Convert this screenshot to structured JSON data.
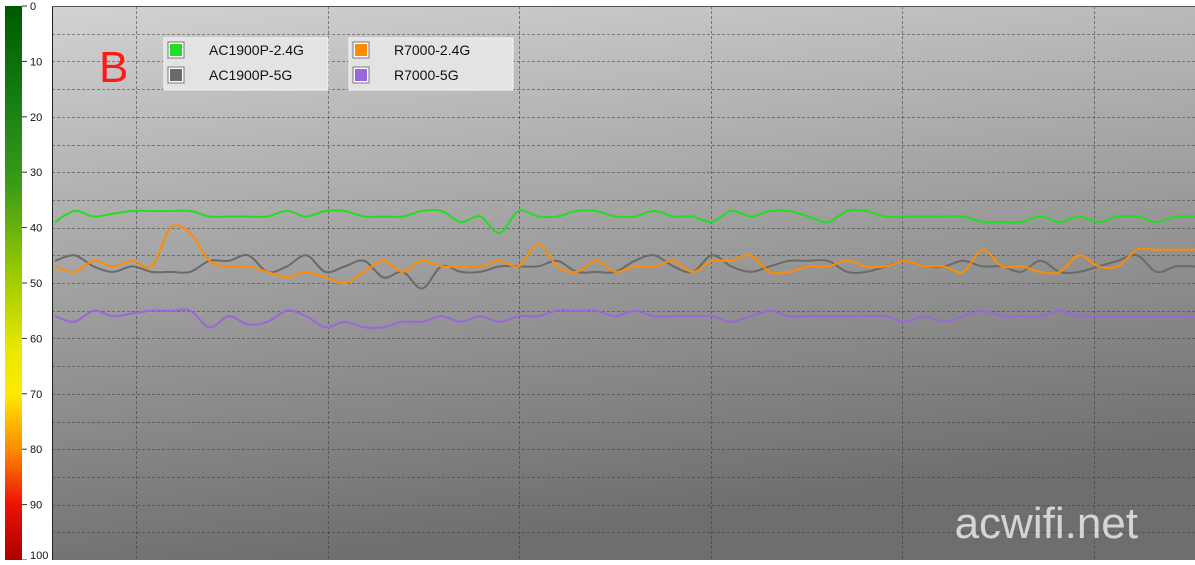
{
  "panel_letter": "B",
  "watermark": "acwifi.net",
  "colors": {
    "panel_letter": "#ff1a1a",
    "watermark": "#e8e8e8",
    "plot_grad_top": "#d2d2d2",
    "plot_grad_bottom": "#6e6e6e",
    "legend_bg": "#e3e3e3"
  },
  "chart_data": {
    "type": "line",
    "title": "",
    "xlabel": "",
    "ylabel": "",
    "ylim": [
      0,
      100
    ],
    "y_inverted": true,
    "y_ticks": [
      "0",
      "10",
      "20",
      "30",
      "40",
      "50",
      "60",
      "70",
      "80",
      "90",
      "100"
    ],
    "grid": true,
    "legend_position": "top-left",
    "x_count": 60,
    "series": [
      {
        "name": "AC1900P-2.4G",
        "color": "#22dd22",
        "values": [
          39,
          37,
          38,
          37.5,
          37,
          37,
          37,
          37,
          38,
          38,
          38,
          38,
          37,
          38,
          37,
          37,
          38,
          38,
          38,
          37,
          37,
          39,
          38,
          41,
          37,
          38,
          38,
          37,
          37,
          38,
          38,
          37,
          38,
          38,
          39,
          37,
          38,
          37,
          37,
          38,
          39,
          37,
          37,
          38,
          38,
          38,
          38,
          38,
          39,
          39,
          39,
          38,
          39,
          38,
          39,
          38,
          38,
          39,
          38,
          38
        ]
      },
      {
        "name": "AC1900P-5G",
        "color": "#6a6a6a",
        "values": [
          46,
          45,
          47,
          48,
          47,
          48,
          48,
          48,
          46,
          46,
          45,
          48,
          47,
          45,
          48,
          47,
          46,
          49,
          48,
          51,
          47,
          48,
          48,
          47,
          47,
          47,
          46,
          48,
          48,
          48,
          46,
          45,
          47,
          48,
          45,
          47,
          48,
          47,
          46,
          46,
          46,
          48,
          48,
          47,
          46,
          47,
          47,
          46,
          47,
          47,
          48,
          46,
          48,
          48,
          47,
          46,
          45,
          48,
          47,
          47
        ]
      },
      {
        "name": "R7000-2.4G",
        "color": "#ff8c00",
        "values": [
          47,
          48,
          46,
          47,
          46,
          47,
          40,
          41,
          46,
          47,
          47,
          48,
          49,
          48,
          49,
          50,
          48,
          46,
          48,
          46,
          47,
          47,
          47,
          46,
          47,
          43,
          47,
          48,
          46,
          48,
          47,
          47,
          46,
          48,
          46,
          46,
          45,
          48,
          48,
          47,
          47,
          46,
          47,
          47,
          46,
          47,
          47,
          48,
          44,
          47,
          47,
          48,
          48,
          45,
          47,
          47,
          44,
          44,
          44,
          44
        ]
      },
      {
        "name": "R7000-5G",
        "color": "#9966dd",
        "values": [
          56,
          57,
          55,
          56,
          55.5,
          55,
          55,
          55,
          58,
          56,
          57.5,
          57,
          55,
          56,
          58,
          57,
          58,
          58,
          57,
          57,
          56,
          57,
          56,
          57,
          56,
          56,
          55,
          55,
          55,
          56,
          55,
          56,
          56,
          56,
          56,
          57,
          56,
          55,
          56,
          56,
          56,
          56,
          56,
          56,
          57,
          56,
          57,
          56,
          55,
          56,
          56,
          56,
          55,
          56,
          56,
          56,
          56,
          56,
          56,
          56
        ]
      }
    ]
  }
}
